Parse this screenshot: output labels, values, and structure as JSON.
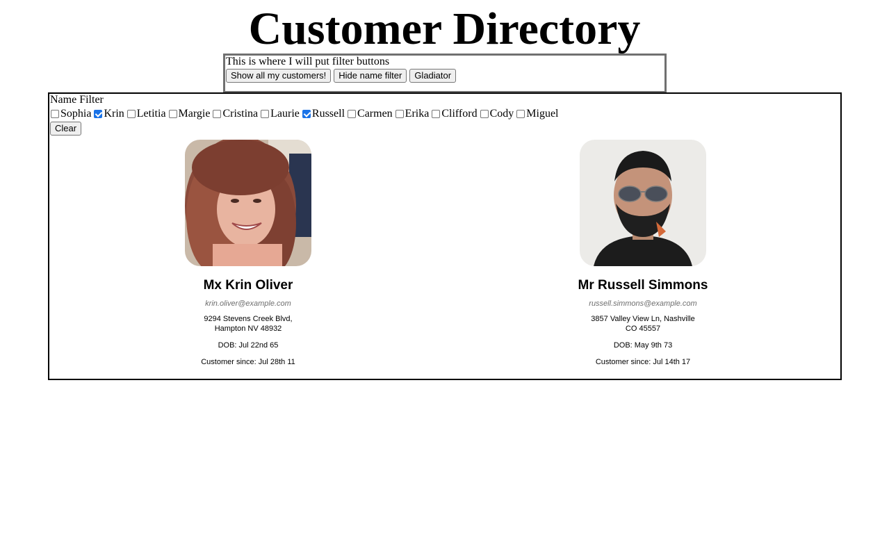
{
  "page_title": "Customer Directory",
  "filter_panel": {
    "text": "This is where I will put filter buttons",
    "buttons": [
      "Show all my customers!",
      "Hide name filter",
      "Gladiator"
    ]
  },
  "name_filter": {
    "label": "Name Filter",
    "options": [
      {
        "label": "Sophia",
        "checked": false
      },
      {
        "label": "Krin",
        "checked": true
      },
      {
        "label": "Letitia",
        "checked": false
      },
      {
        "label": "Margie",
        "checked": false
      },
      {
        "label": "Cristina",
        "checked": false
      },
      {
        "label": "Laurie",
        "checked": false
      },
      {
        "label": "Russell",
        "checked": true
      },
      {
        "label": "Carmen",
        "checked": false
      },
      {
        "label": "Erika",
        "checked": false
      },
      {
        "label": "Clifford",
        "checked": false
      },
      {
        "label": "Cody",
        "checked": false
      },
      {
        "label": "Miguel",
        "checked": false
      }
    ],
    "clear_label": "Clear"
  },
  "customers": [
    {
      "name": "Mx Krin Oliver",
      "email": "krin.oliver@example.com",
      "address_line1": "9294 Stevens Creek Blvd,",
      "address_line2": "Hampton NV 48932",
      "dob": "DOB: Jul 22nd 65",
      "since": "Customer since: Jul 28th 11"
    },
    {
      "name": "Mr Russell Simmons",
      "email": "russell.simmons@example.com",
      "address_line1": "3857 Valley View Ln, Nashville",
      "address_line2": "CO 45557",
      "dob": "DOB: May 9th 73",
      "since": "Customer since: Jul 14th 17"
    }
  ],
  "colors": {
    "checkbox_checked": "#1a73e8",
    "email_text": "#6e6e6e",
    "filter_border": "#707070"
  }
}
